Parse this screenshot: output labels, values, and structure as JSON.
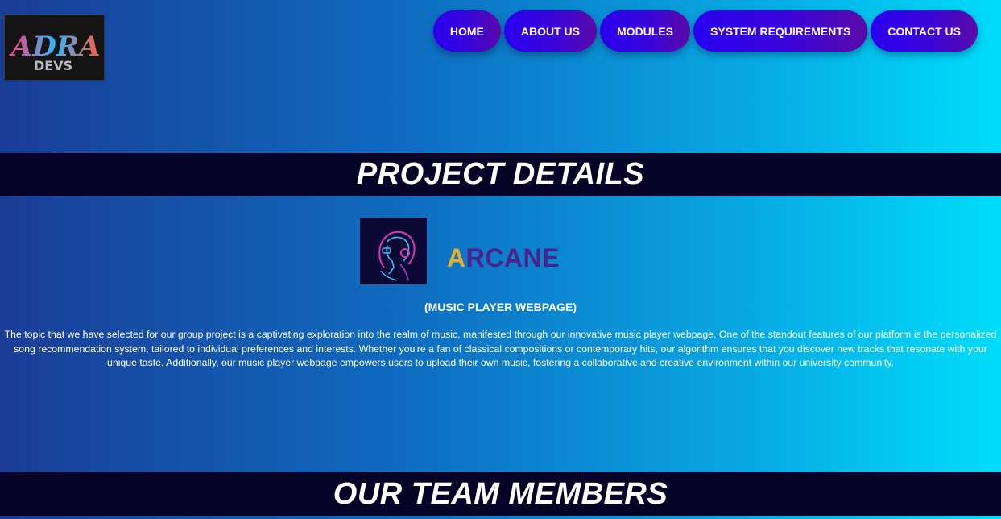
{
  "logo": {
    "line1": "ADRA",
    "line2": "DEVS"
  },
  "nav": {
    "items": [
      {
        "label": "HOME"
      },
      {
        "label": "ABOUT US"
      },
      {
        "label": "MODULES"
      },
      {
        "label": "SYSTEM REQUIREMENTS"
      },
      {
        "label": "CONTACT US"
      }
    ]
  },
  "project": {
    "heading": "PROJECT DETAILS",
    "brand_first_letter": "A",
    "brand_rest": "RCANE",
    "subtitle": "(MUSIC PLAYER WEBPAGE)",
    "description": "The topic that we have selected for our group project is a captivating exploration into the realm of music, manifested through our innovative music player webpage. One of the standout features of our platform is the personalized song recommendation system, tailored to individual preferences and interests. Whether you're a fan of classical compositions or contemporary hits, our algorithm ensures that you discover new tracks that resonate with your unique taste. Additionally, our music player webpage empowers users to upload their own music, fostering a collaborative and creative environment within our university community."
  },
  "team": {
    "heading": "OUR TEAM MEMBERS"
  },
  "colors": {
    "nav_button": "#2a00ef",
    "band": "#050226",
    "brand_accent": "#e2b02a",
    "brand_main": "#4a2290"
  }
}
